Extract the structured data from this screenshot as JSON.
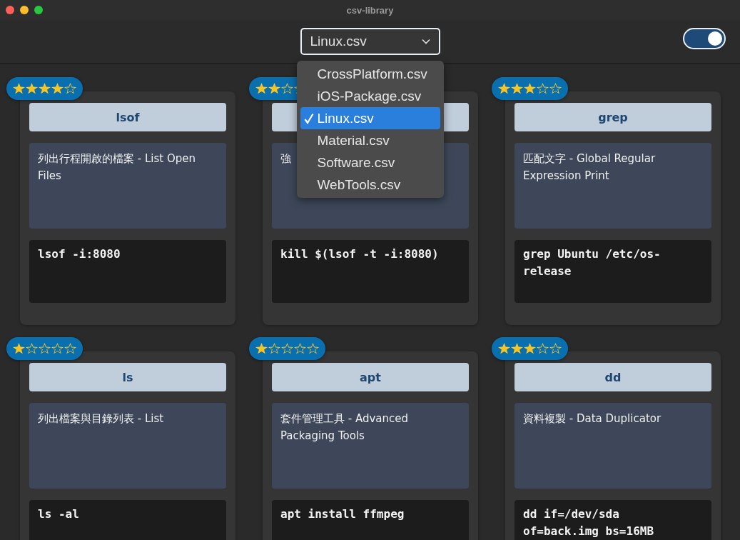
{
  "window": {
    "title": "csv-library"
  },
  "file_picker": {
    "value": "Linux.csv",
    "expanded": true,
    "options": [
      {
        "label": "CrossPlatform.csv",
        "selected": false
      },
      {
        "label": "iOS-Package.csv",
        "selected": false
      },
      {
        "label": "Linux.csv",
        "selected": true
      },
      {
        "label": "Material.csv",
        "selected": false
      },
      {
        "label": "Software.csv",
        "selected": false
      },
      {
        "label": "WebTools.csv",
        "selected": false
      }
    ]
  },
  "toggle": {
    "on": true
  },
  "cards": [
    {
      "stars": 4,
      "title": "lsof",
      "description": "列出行程開啟的檔案 - List Open Files",
      "command": "lsof -i:8080"
    },
    {
      "stars": 2,
      "description": "強",
      "command": "kill $(lsof -t -i:8080)"
    },
    {
      "stars": 3,
      "title": "grep",
      "description": "匹配文字 - Global Regular Expression Print",
      "command": "grep Ubuntu /etc/os-release"
    },
    {
      "stars": 1,
      "title": "ls",
      "description": "列出檔案與目錄列表 - List",
      "command": "ls -al"
    },
    {
      "stars": 1,
      "title": "apt",
      "description": "套件管理工具 - Advanced Packaging Tools",
      "command": "apt install ffmpeg"
    },
    {
      "stars": 3,
      "title": "dd",
      "description": "資料複製 - Data Duplicator",
      "command": "dd if=/dev/sda of=back.img bs=16MB"
    }
  ]
}
